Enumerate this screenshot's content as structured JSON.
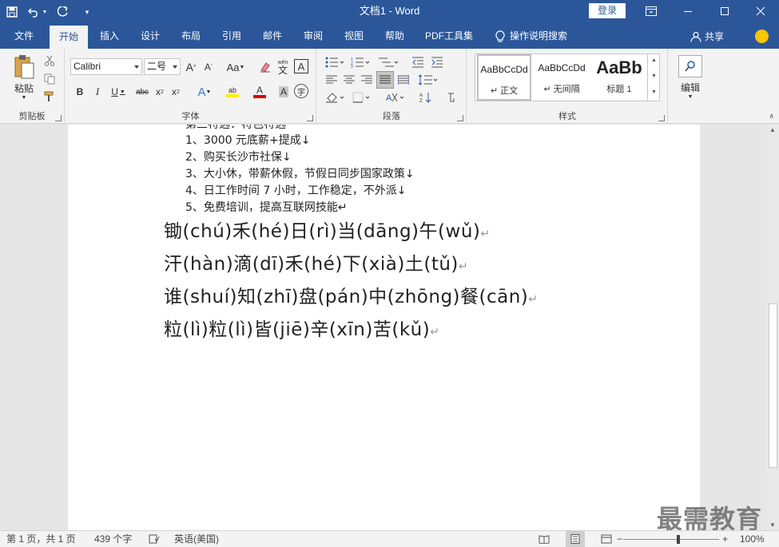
{
  "window": {
    "title": "文档1  -  Word",
    "login_label": "登录"
  },
  "tabs": [
    "文件",
    "开始",
    "插入",
    "设计",
    "布局",
    "引用",
    "邮件",
    "审阅",
    "视图",
    "帮助",
    "PDF工具集"
  ],
  "tell_me": "操作说明搜索",
  "share_label": "共享",
  "ribbon": {
    "clipboard": {
      "paste_label": "粘贴",
      "group_label": "剪贴板"
    },
    "font": {
      "font_name": "Calibri",
      "font_size": "二号",
      "group_label": "字体",
      "phonetic_label": "wén"
    },
    "paragraph": {
      "group_label": "段落"
    },
    "styles": {
      "group_label": "样式",
      "items": [
        {
          "sample": "AaBbCcDd",
          "name": "↵ 正文"
        },
        {
          "sample": "AaBbCcDd",
          "name": "↵ 无间隔"
        },
        {
          "sample": "AaBb",
          "name": "标题 1"
        }
      ]
    },
    "editing": {
      "label": "编辑"
    }
  },
  "document": {
    "partial_line": "第三特选：特色特选",
    "list_items": [
      "1、3000 元底薪+提成↓",
      "2、购买长沙市社保↓",
      "3、大小休，带薪休假，节假日同步国家政策↓",
      "4、日工作时间 7 小时，工作稳定，不外派↓",
      "5、免费培训，提高互联网技能↵"
    ],
    "pinyin_lines": [
      "锄(chú)禾(hé)日(rì)当(dāng)午(wǔ)",
      "汗(hàn)滴(dī)禾(hé)下(xià)土(tǔ)",
      "谁(shuí)知(zhī)盘(pán)中(zhōng)餐(cān)",
      "粒(lì)粒(lì)皆(jiē)辛(xīn)苦(kǔ)"
    ],
    "paragraph_mark": "↵"
  },
  "watermark": "最需教育",
  "status": {
    "page": "第 1 页，共 1 页",
    "words": "439 个字",
    "language": "英语(美国)",
    "zoom_minus": "−",
    "zoom_plus": "+",
    "zoom": "100%",
    "zoom_level_percent": 100
  }
}
